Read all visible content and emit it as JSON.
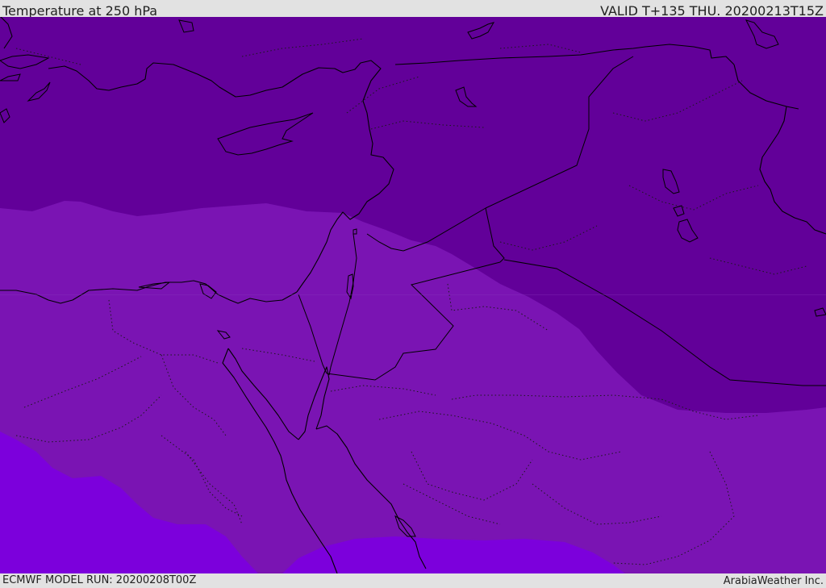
{
  "header": {
    "title": "Temperature at 250 hPa",
    "valid": "VALID T+135 THU. 20200213T15Z"
  },
  "footer": {
    "model_run": "ECMWF MODEL RUN: 20200208T00Z",
    "credit": "ArabiaWeather Inc."
  },
  "map": {
    "region": "Eastern Mediterranean / Middle East",
    "colors": {
      "band_dark": "#620099",
      "band_mid": "#7a14b3",
      "band_light": "#7c00dc",
      "coastline": "#000000",
      "border_dotted": "#1a1a1a"
    }
  }
}
